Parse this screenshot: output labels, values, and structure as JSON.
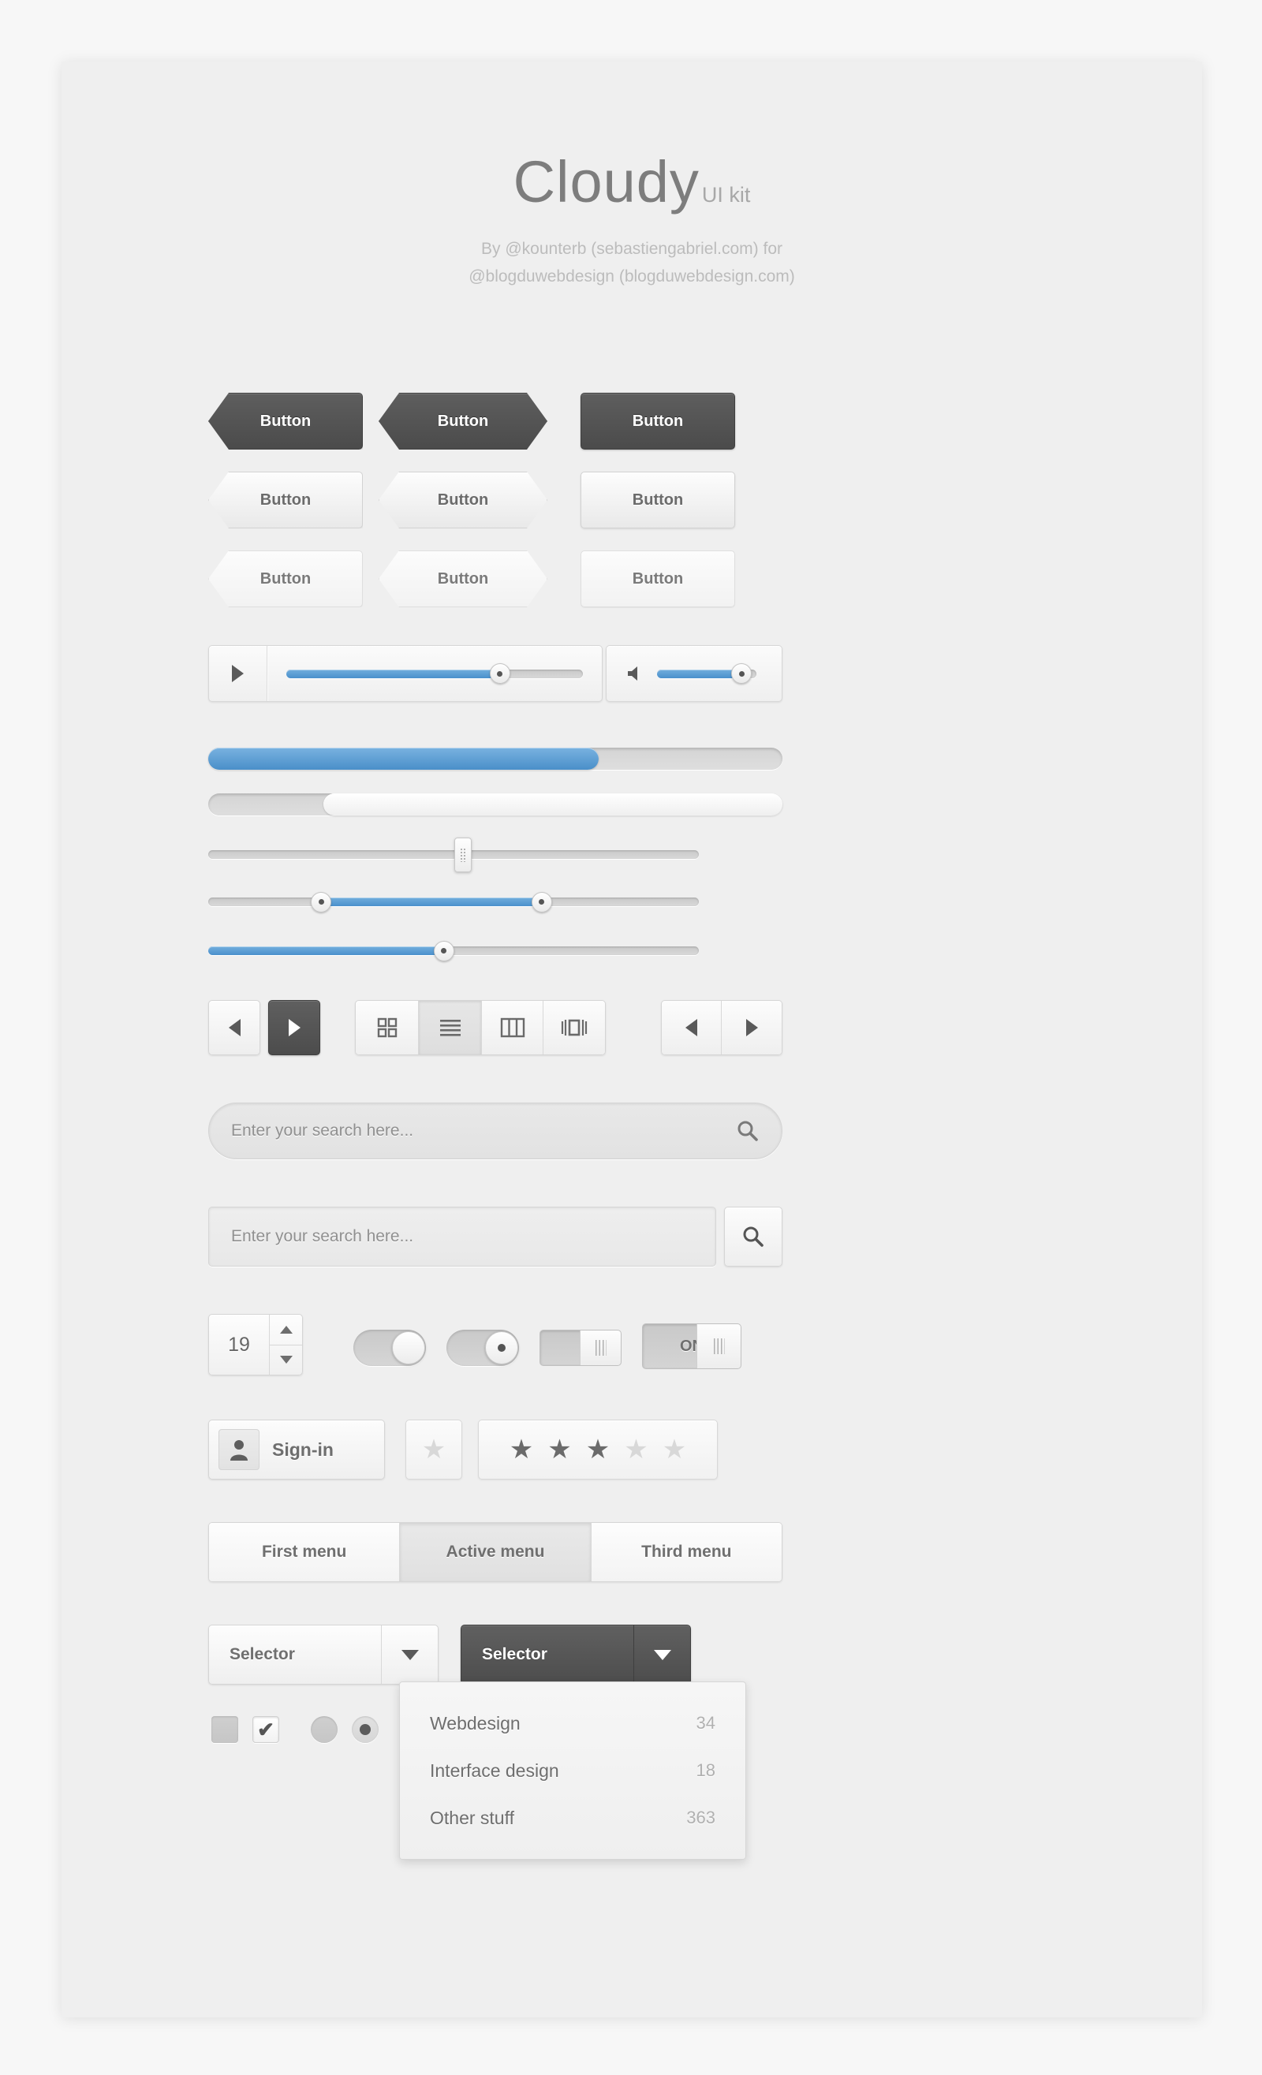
{
  "header": {
    "brand_main": "Cloudy",
    "brand_sub": "UI kit",
    "credit_line1": "By @kounterb (sebastiengabriel.com) for",
    "credit_line2": "@blogduwebdesign (blogduwebdesign.com)"
  },
  "colors": {
    "accent_blue": "#4a90cc",
    "dark_button": "#555555",
    "canvas": "#efefef",
    "text_gray": "#6f6f6f"
  },
  "buttons": {
    "label": "Button",
    "rows": [
      {
        "style": "dark",
        "shapes": [
          "left",
          "both",
          "rect"
        ]
      },
      {
        "style": "light",
        "shapes": [
          "left",
          "both",
          "rect"
        ]
      },
      {
        "style": "flat",
        "shapes": [
          "left",
          "both",
          "rect"
        ]
      }
    ]
  },
  "media_bar": {
    "play_icon": "play-icon",
    "volume_icon": "speaker-icon",
    "progress_percent": 72,
    "volume_percent": 85
  },
  "progress_bars": [
    {
      "name": "blue-progress",
      "percent": 68
    },
    {
      "name": "light-progress",
      "start_percent": 20,
      "end_percent": 100
    }
  ],
  "sliders": [
    {
      "name": "grip-slider",
      "value_percent": 52,
      "fill": false
    },
    {
      "name": "range-slider",
      "low_percent": 23,
      "high_percent": 68,
      "fill": true
    },
    {
      "name": "fill-slider",
      "value_percent": 48,
      "fill": true
    }
  ],
  "toolbar": {
    "prev_icon": "arrow-left-icon",
    "next_icon": "arrow-right-icon",
    "views": [
      {
        "name": "grid-view-icon",
        "active": false
      },
      {
        "name": "list-view-icon",
        "active": true
      },
      {
        "name": "column-view-icon",
        "active": false
      },
      {
        "name": "coverflow-view-icon",
        "active": false
      }
    ]
  },
  "search": {
    "placeholder": "Enter your search here...",
    "icon": "search-icon"
  },
  "stepper": {
    "value": "19",
    "up_icon": "caret-up-icon",
    "down_icon": "caret-down-icon"
  },
  "toggles": {
    "on_label": "ON"
  },
  "signin": {
    "label": "Sign-in",
    "icon": "user-icon"
  },
  "rating": {
    "single_star": "star-icon",
    "filled": 3,
    "total": 5
  },
  "tabs": [
    {
      "label": "First menu",
      "active": false
    },
    {
      "label": "Active menu",
      "active": true
    },
    {
      "label": "Third menu",
      "active": false
    }
  ],
  "selectors": [
    {
      "label": "Selector",
      "style": "light"
    },
    {
      "label": "Selector",
      "style": "dark"
    }
  ],
  "dropdown_menu": [
    {
      "label": "Webdesign",
      "count": "34"
    },
    {
      "label": "Interface design",
      "count": "18"
    },
    {
      "label": "Other stuff",
      "count": "363"
    }
  ],
  "checkboxes": [
    {
      "name": "checkbox-unchecked",
      "checked": false
    },
    {
      "name": "checkbox-checked",
      "checked": true,
      "mark": "✔"
    }
  ],
  "radios": [
    {
      "name": "radio-unselected",
      "selected": false
    },
    {
      "name": "radio-selected",
      "selected": true
    }
  ]
}
